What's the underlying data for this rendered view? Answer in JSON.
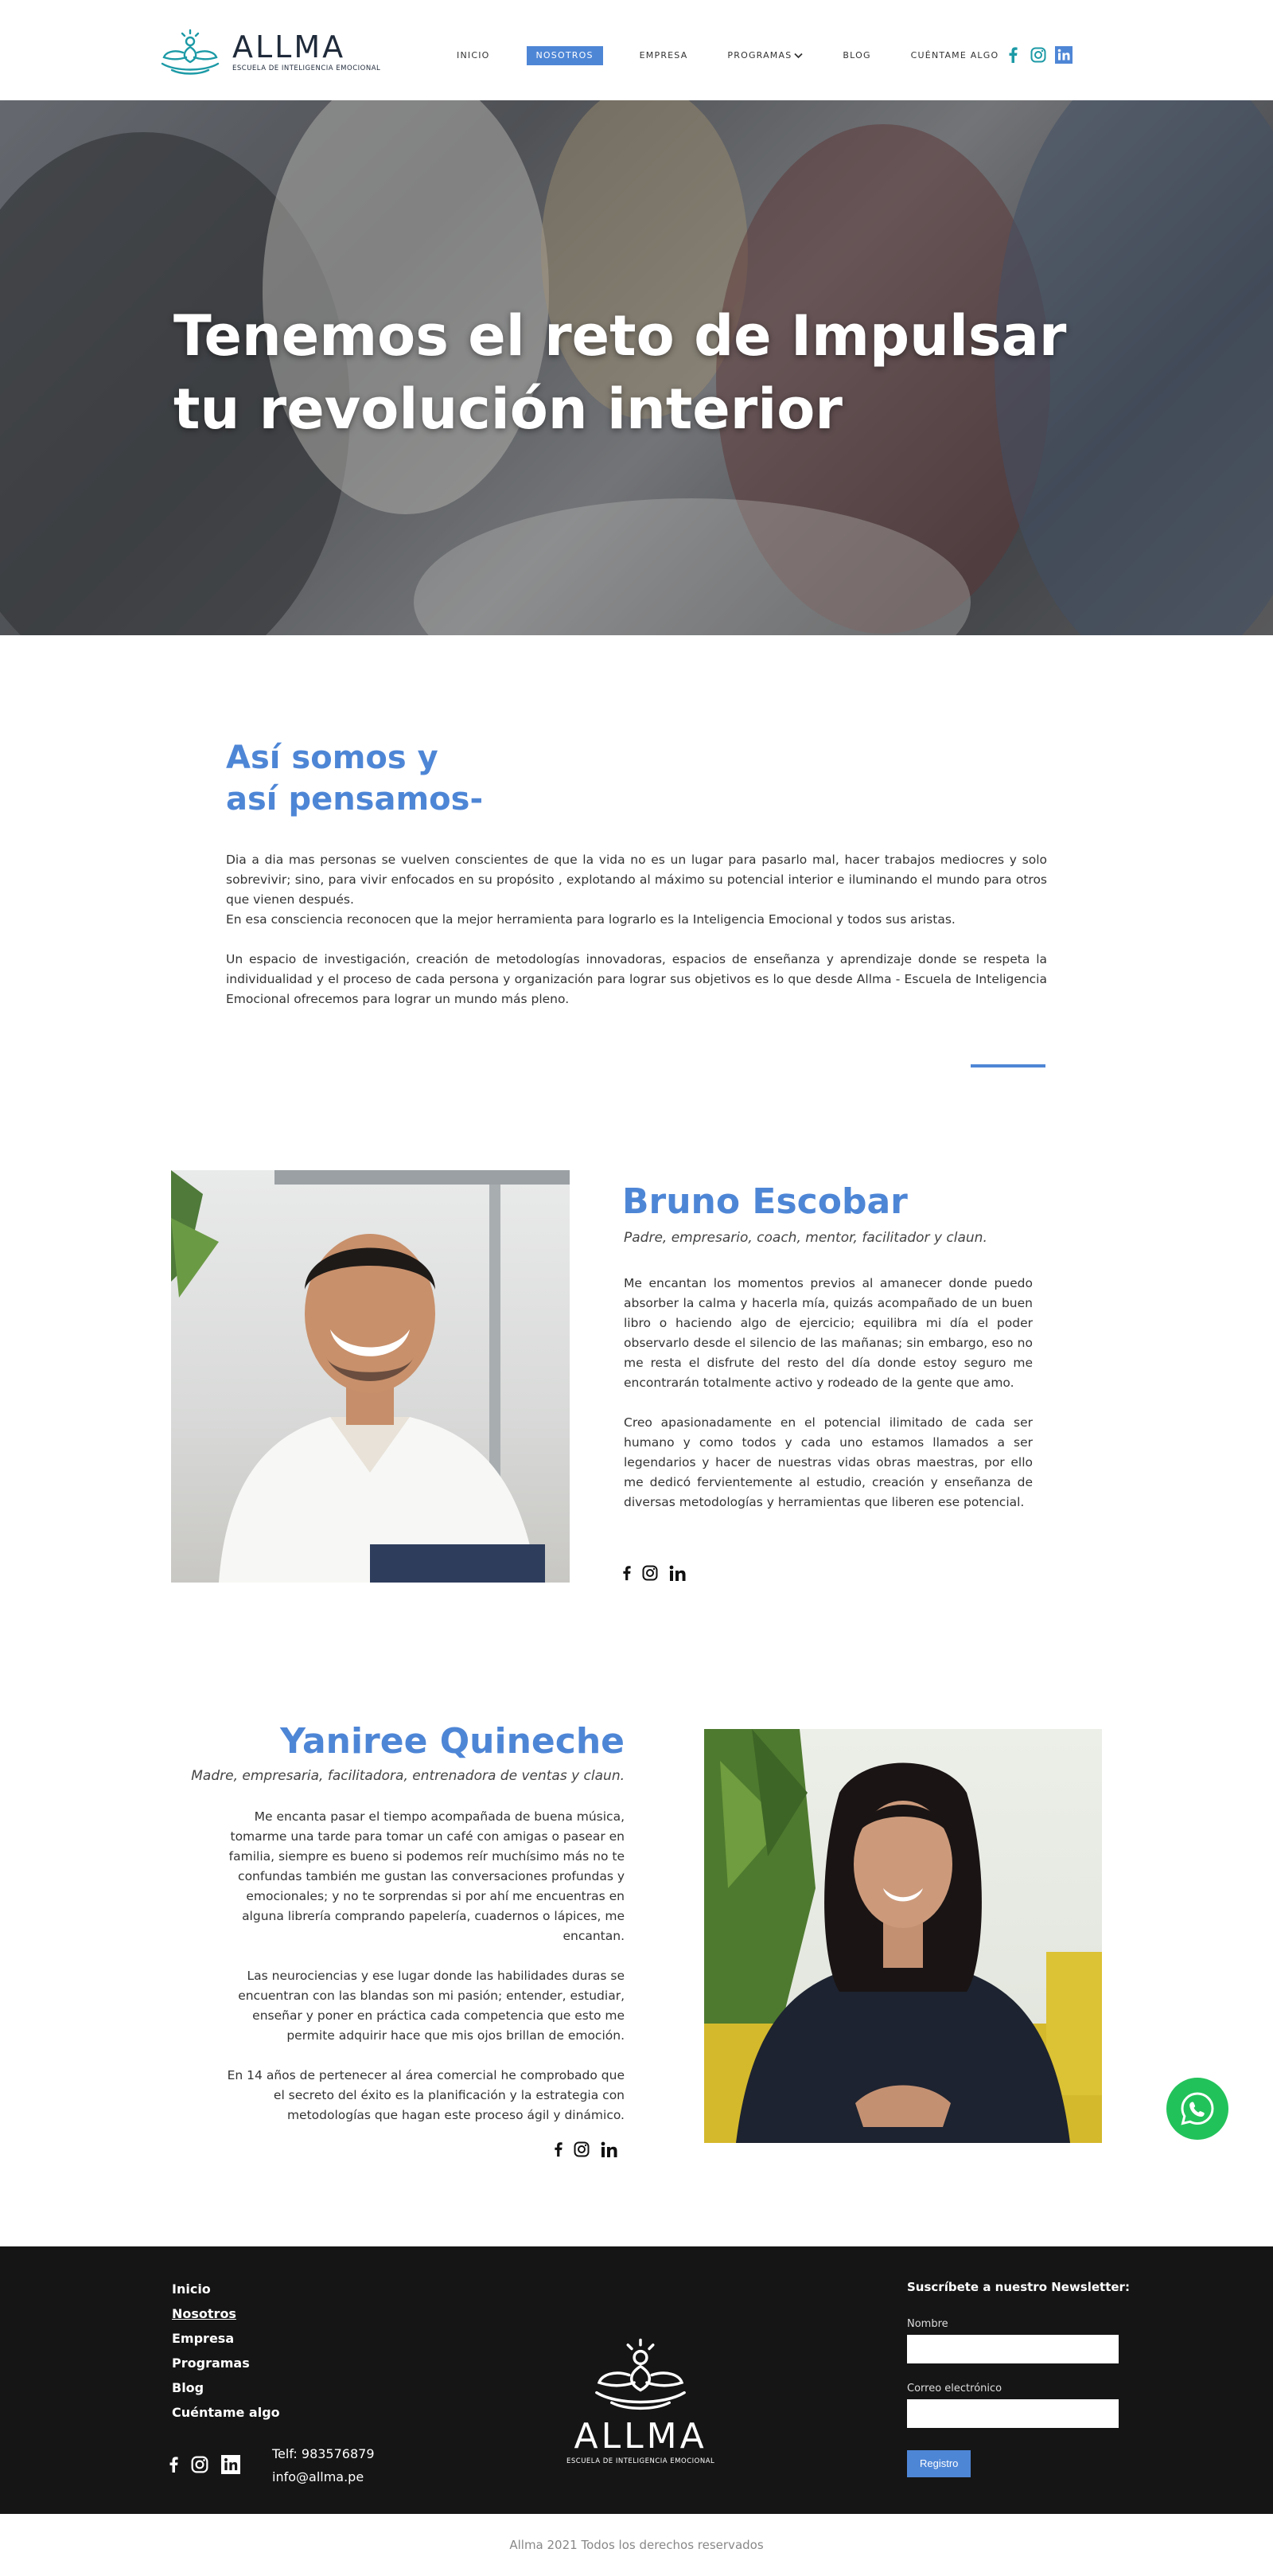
{
  "brand": {
    "name": "ALLMA",
    "subtitle": "ESCUELA DE INTELIGENCIA EMOCIONAL",
    "accent": "#4e86d6",
    "logo_color": "#1c9aa6"
  },
  "nav": [
    {
      "label": "INICIO",
      "active": false
    },
    {
      "label": "NOSOTROS",
      "active": true
    },
    {
      "label": "EMPRESA",
      "active": false
    },
    {
      "label": "PROGRAMAS",
      "active": false,
      "has_dropdown": true
    },
    {
      "label": "BLOG",
      "active": false
    },
    {
      "label": "CUÉNTAME ALGO",
      "active": false
    }
  ],
  "header_social": [
    "facebook-icon",
    "instagram-icon",
    "linkedin-icon"
  ],
  "hero": {
    "line1": "Tenemos el reto de Impulsar",
    "line2": "tu revolución interior"
  },
  "about": {
    "title_line1": "Así somos y",
    "title_line2": "así pensamos-",
    "p1": "Dia a dia mas personas se vuelven conscientes de que la vida no es un lugar para pasarlo mal, hacer trabajos mediocres y solo sobrevivir; sino, para vivir enfocados en su propósito , explotando al máximo su potencial interior e iluminando el mundo para otros que vienen después.",
    "p1b": "En esa consciencia reconocen que la mejor herramienta para lograrlo es la Inteligencia Emocional y todos sus aristas.",
    "p2": "Un espacio de investigación, creación de metodologías innovadoras, espacios de enseñanza y aprendizaje donde se respeta la individualidad y el proceso de cada persona y organización para lograr sus objetivos es lo que desde Allma - Escuela de Inteligencia Emocional ofrecemos para lograr un mundo más pleno."
  },
  "bruno": {
    "name": "Bruno Escobar",
    "role": "Padre, empresario, coach, mentor, facilitador y claun.",
    "p1": "Me encantan los momentos previos al amanecer donde puedo absorber la calma y hacerla mía, quizás acompañado de un buen libro o haciendo algo de ejercicio; equilibra mi día el poder observarlo desde el silencio de las mañanas; sin embargo, eso no me resta el disfrute del resto del día donde estoy seguro me encontrarán totalmente activo y rodeado de la gente que amo.",
    "p2": "Creo apasionadamente en el potencial ilimitado de cada ser humano y como todos y cada uno estamos llamados a ser legendarios y hacer de nuestras vidas obras maestras, por ello me dedicó fervientemente al estudio, creación y enseñanza de diversas metodologías y herramientas que liberen ese potencial."
  },
  "yaniree": {
    "name": "Yaniree Quineche",
    "role": "Madre, empresaria, facilitadora, entrenadora de ventas y claun.",
    "p1": "Me encanta pasar el tiempo acompañada de buena música, tomarme una tarde para tomar un café con amigas o pasear en familia, siempre es bueno si podemos reír muchísimo más no te confundas también me gustan las conversaciones profundas y emocionales; y no te sorprendas si por ahí me encuentras en alguna librería comprando papelería, cuadernos o lápices, me encantan.",
    "p2": "Las neurociencias y ese lugar donde las habilidades duras se encuentran con las blandas son mi pasión; entender, estudiar, enseñar y poner en práctica cada competencia que esto me permite adquirir hace que mis ojos brillan de emoción.",
    "p3": "En 14 años de pertenecer al área comercial he comprobado que el secreto del éxito es la planificación y la estrategia con metodologías que hagan este proceso ágil y dinámico."
  },
  "footer": {
    "links": [
      {
        "label": "Inicio",
        "active": false
      },
      {
        "label": "Nosotros",
        "active": true
      },
      {
        "label": "Empresa",
        "active": false
      },
      {
        "label": "Programas",
        "active": false
      },
      {
        "label": "Blog",
        "active": false
      },
      {
        "label": "Cuéntame algo",
        "active": false
      }
    ],
    "phone": "Telf: 983576879",
    "email": "info@allma.pe",
    "newsletter_title": "Suscríbete a nuestro Newsletter:",
    "name_label": "Nombre",
    "email_label": "Correo electrónico",
    "button": "Registro"
  },
  "copyright": "Allma 2021 Todos los derechos reservados"
}
